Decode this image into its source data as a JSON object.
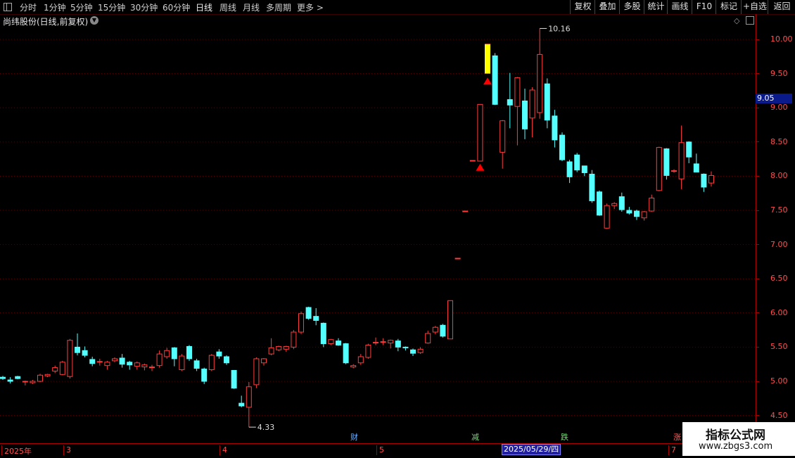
{
  "toolbar": {
    "periods": [
      "分时",
      "1分钟",
      "5分钟",
      "15分钟",
      "30分钟",
      "60分钟",
      "日线",
      "周线",
      "月线",
      "多周期",
      "更多 >"
    ],
    "active_period": "日线",
    "right_buttons": [
      "复权",
      "叠加",
      "多股",
      "统计",
      "画线",
      "F10",
      "标记",
      "+自选",
      "返回"
    ]
  },
  "chart_header": {
    "title": "尚纬股份(日线,前复权)"
  },
  "cursor": {
    "price_label": "9.05",
    "date_label": "2025/05/29/四"
  },
  "event_markers": [
    {
      "label": "财",
      "color": "#6ab0ff"
    },
    {
      "label": "减",
      "color": "#7ad77a"
    },
    {
      "label": "跌",
      "color": "#7ad77a"
    },
    {
      "label": "涨",
      "color": "#ff6060"
    }
  ],
  "colors": {
    "up": "#ff3c3c",
    "down": "#54ffff",
    "axis": "#aa0000",
    "grid": "#5a0000",
    "signal": "#ffff00",
    "marker": "#ff0000"
  },
  "watermark": {
    "title": "指标公式网",
    "url": "www.zbgs3.com"
  },
  "chart_data": {
    "type": "candlestick",
    "y_ticks": [
      "10.00",
      "9.50",
      "9.00",
      "8.50",
      "8.00",
      "7.50",
      "7.00",
      "6.50",
      "6.00",
      "5.50",
      "5.00",
      "4.50"
    ],
    "ylim": [
      4.3,
      10.35
    ],
    "x_labels": [
      "2025年",
      "3",
      "4",
      "5",
      "7"
    ],
    "annotations": [
      {
        "label": "10.16",
        "price": 10.16
      },
      {
        "label": "4.33",
        "price": 4.33
      }
    ],
    "candles": [
      [
        5.06,
        5.08,
        5.02,
        5.04
      ],
      [
        5.02,
        5.06,
        4.97,
        5.0
      ],
      [
        5.07,
        5.08,
        5.03,
        5.04
      ],
      [
        5.0,
        5.01,
        4.94,
        5.0
      ],
      [
        4.98,
        5.02,
        4.96,
        5.0
      ],
      [
        5.0,
        5.11,
        4.99,
        5.09
      ],
      [
        5.08,
        5.11,
        5.06,
        5.1
      ],
      [
        5.15,
        5.23,
        5.12,
        5.2
      ],
      [
        5.1,
        5.3,
        5.09,
        5.28
      ],
      [
        5.07,
        5.62,
        5.04,
        5.6
      ],
      [
        5.5,
        5.7,
        5.38,
        5.42
      ],
      [
        5.45,
        5.51,
        5.35,
        5.38
      ],
      [
        5.32,
        5.36,
        5.22,
        5.26
      ],
      [
        5.28,
        5.33,
        5.23,
        5.29
      ],
      [
        5.23,
        5.3,
        5.17,
        5.28
      ],
      [
        5.3,
        5.35,
        5.28,
        5.33
      ],
      [
        5.34,
        5.4,
        5.2,
        5.25
      ],
      [
        5.28,
        5.3,
        5.17,
        5.24
      ],
      [
        5.22,
        5.29,
        5.17,
        5.27
      ],
      [
        5.21,
        5.26,
        5.16,
        5.24
      ],
      [
        5.2,
        5.24,
        5.15,
        5.21
      ],
      [
        5.23,
        5.45,
        5.2,
        5.4
      ],
      [
        5.36,
        5.49,
        5.33,
        5.45
      ],
      [
        5.49,
        5.5,
        5.22,
        5.33
      ],
      [
        5.17,
        5.4,
        5.15,
        5.37
      ],
      [
        5.51,
        5.53,
        5.3,
        5.33
      ],
      [
        5.3,
        5.33,
        5.15,
        5.19
      ],
      [
        5.18,
        5.2,
        4.96,
        5.0
      ],
      [
        5.17,
        5.4,
        5.15,
        5.38
      ],
      [
        5.43,
        5.47,
        5.33,
        5.37
      ],
      [
        5.36,
        5.38,
        5.24,
        5.27
      ],
      [
        5.16,
        5.15,
        4.89,
        4.9
      ],
      [
        4.68,
        4.79,
        4.62,
        4.64
      ],
      [
        4.62,
        4.99,
        4.33,
        4.92
      ],
      [
        4.95,
        5.35,
        4.9,
        5.33
      ],
      [
        5.27,
        5.34,
        5.23,
        5.33
      ],
      [
        5.4,
        5.63,
        5.38,
        5.49
      ],
      [
        5.46,
        5.52,
        5.44,
        5.51
      ],
      [
        5.47,
        5.52,
        5.43,
        5.51
      ],
      [
        5.5,
        5.75,
        5.47,
        5.72
      ],
      [
        5.72,
        6.02,
        5.69,
        5.99
      ],
      [
        6.08,
        6.09,
        5.9,
        5.92
      ],
      [
        5.95,
        6.07,
        5.82,
        5.89
      ],
      [
        5.85,
        5.86,
        5.5,
        5.55
      ],
      [
        5.55,
        5.62,
        5.53,
        5.61
      ],
      [
        5.59,
        5.63,
        5.52,
        5.53
      ],
      [
        5.55,
        5.56,
        5.25,
        5.27
      ],
      [
        5.21,
        5.25,
        5.19,
        5.23
      ],
      [
        5.27,
        5.4,
        5.24,
        5.36
      ],
      [
        5.35,
        5.55,
        5.33,
        5.53
      ],
      [
        5.56,
        5.64,
        5.53,
        5.57
      ],
      [
        5.57,
        5.63,
        5.53,
        5.58
      ],
      [
        5.56,
        5.61,
        5.48,
        5.6
      ],
      [
        5.59,
        5.62,
        5.44,
        5.5
      ],
      [
        5.5,
        5.51,
        5.45,
        5.49
      ],
      [
        5.46,
        5.48,
        5.37,
        5.41
      ],
      [
        5.42,
        5.5,
        5.4,
        5.47
      ],
      [
        5.56,
        5.74,
        5.55,
        5.7
      ],
      [
        5.72,
        5.81,
        5.69,
        5.79
      ],
      [
        5.82,
        5.84,
        5.64,
        5.66
      ],
      [
        5.62,
        6.18,
        5.62,
        6.18
      ],
      [
        6.8,
        6.8,
        6.8,
        6.8
      ],
      [
        7.49,
        7.49,
        7.49,
        7.49
      ],
      [
        8.23,
        8.23,
        8.23,
        8.23
      ],
      [
        8.22,
        9.05,
        8.22,
        9.05
      ],
      [
        9.93,
        9.93,
        9.93,
        9.93
      ],
      [
        9.76,
        9.8,
        9.04,
        9.05
      ],
      [
        8.35,
        8.82,
        8.11,
        8.81
      ],
      [
        9.12,
        9.51,
        8.7,
        9.04
      ],
      [
        9.02,
        9.45,
        8.45,
        9.44
      ],
      [
        9.1,
        9.28,
        8.54,
        8.69
      ],
      [
        8.85,
        9.3,
        8.57,
        9.26
      ],
      [
        8.93,
        10.16,
        8.84,
        9.78
      ],
      [
        9.35,
        9.43,
        8.7,
        8.82
      ],
      [
        8.88,
        8.97,
        8.42,
        8.53
      ],
      [
        8.6,
        8.64,
        8.22,
        8.24
      ],
      [
        8.21,
        8.24,
        7.9,
        7.99
      ],
      [
        8.31,
        8.34,
        8.06,
        8.09
      ],
      [
        8.15,
        8.14,
        8.0,
        8.05
      ],
      [
        8.03,
        8.09,
        7.61,
        7.64
      ],
      [
        7.77,
        7.79,
        7.42,
        7.43
      ],
      [
        7.24,
        7.6,
        7.23,
        7.57
      ],
      [
        7.57,
        7.62,
        7.52,
        7.6
      ],
      [
        7.7,
        7.76,
        7.48,
        7.51
      ],
      [
        7.5,
        7.55,
        7.44,
        7.46
      ],
      [
        7.49,
        7.51,
        7.36,
        7.41
      ],
      [
        7.39,
        7.49,
        7.35,
        7.48
      ],
      [
        7.49,
        7.73,
        7.48,
        7.68
      ],
      [
        7.79,
        8.43,
        7.78,
        8.42
      ],
      [
        8.4,
        8.41,
        7.95,
        8.01
      ],
      [
        8.07,
        8.1,
        8.05,
        8.08
      ],
      [
        7.96,
        8.74,
        7.81,
        8.49
      ],
      [
        8.5,
        8.51,
        8.19,
        8.28
      ],
      [
        8.18,
        8.33,
        8.06,
        8.06
      ],
      [
        8.03,
        8.04,
        7.77,
        7.84
      ],
      [
        7.9,
        8.07,
        7.85,
        8.01
      ]
    ]
  }
}
